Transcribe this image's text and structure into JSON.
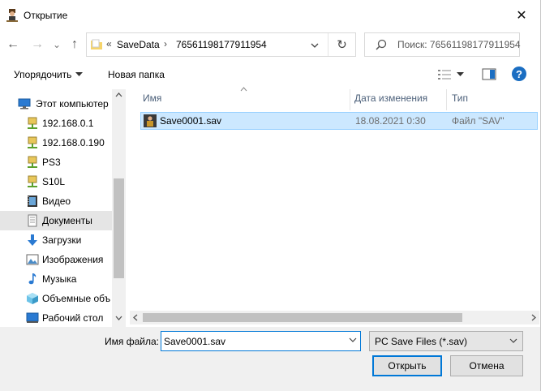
{
  "window": {
    "title": "Открытие",
    "close_glyph": "✕"
  },
  "nav": {
    "back_glyph": "←",
    "forward_glyph": "→",
    "recent_glyph": "⌄",
    "up_glyph": "↑",
    "address": {
      "chevrons": "«",
      "crumbs": [
        "SaveData",
        "76561198177911954"
      ],
      "separator": "›"
    },
    "refresh_glyph": "↻",
    "search_placeholder": "Поиск: 76561198177911954"
  },
  "toolbar": {
    "organize": "Упорядочить",
    "new_folder": "Новая папка",
    "help": "?"
  },
  "sidebar": {
    "items": [
      {
        "label": "Этот компьютер",
        "icon": "computer-icon"
      },
      {
        "label": "192.168.0.1",
        "icon": "network-drive-icon"
      },
      {
        "label": "192.168.0.190",
        "icon": "network-drive-icon"
      },
      {
        "label": "PS3",
        "icon": "network-drive-icon"
      },
      {
        "label": "S10L",
        "icon": "network-drive-icon"
      },
      {
        "label": "Видео",
        "icon": "video-folder-icon"
      },
      {
        "label": "Документы",
        "icon": "documents-folder-icon",
        "selected": true
      },
      {
        "label": "Загрузки",
        "icon": "downloads-folder-icon"
      },
      {
        "label": "Изображения",
        "icon": "pictures-folder-icon"
      },
      {
        "label": "Музыка",
        "icon": "music-folder-icon"
      },
      {
        "label": "Объемные объ",
        "icon": "3d-objects-folder-icon"
      },
      {
        "label": "Рабочий стол",
        "icon": "desktop-folder-icon"
      }
    ]
  },
  "columns": {
    "name": "Имя",
    "date": "Дата изменения",
    "type": "Тип"
  },
  "files": [
    {
      "name": "Save0001.sav",
      "date": "18.08.2021 0:30",
      "type": "Файл \"SAV\""
    }
  ],
  "footer": {
    "filename_label": "Имя файла:",
    "filename_value": "Save0001.sav",
    "filetype_value": "PC Save Files (*.sav)",
    "open_label": "Открыть",
    "cancel_label": "Отмена"
  },
  "colors": {
    "accent": "#0078d7",
    "selection_bg": "#cce8ff",
    "selection_border": "#99d1ff",
    "help_blue": "#1b6ec2"
  }
}
